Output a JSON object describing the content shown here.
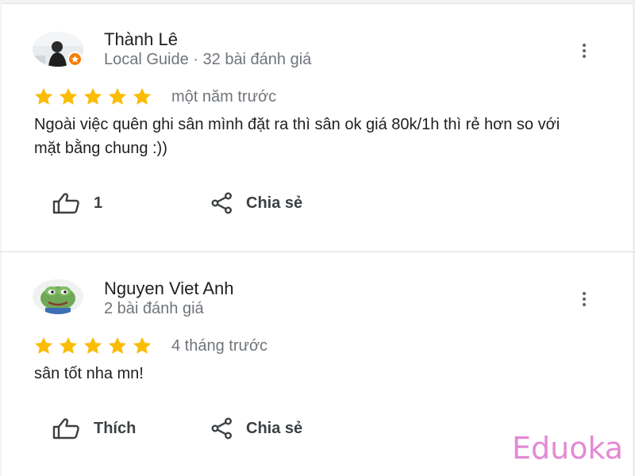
{
  "reviews": [
    {
      "author": "Thành Lê",
      "meta": "Local Guide · 32 bài đánh giá",
      "avatar_icon": "person-photo-avatar",
      "badge_icon": "local-guide-badge-icon",
      "rating": 5,
      "time": "một năm trước",
      "text": "Ngoài việc quên ghi sân mình đặt ra thì sân ok giá 80k/1h thì rẻ hơn so với mặt bằng chung :))",
      "like_label": "1",
      "share_label": "Chia sẻ"
    },
    {
      "author": "Nguyen Viet Anh",
      "meta": "2 bài đánh giá",
      "avatar_icon": "frog-cartoon-avatar",
      "rating": 5,
      "time": "4 tháng trước",
      "text": "sân tốt nha mn!",
      "like_label": "Thích",
      "share_label": "Chia sẻ"
    }
  ],
  "icons": {
    "more": "more-vertical-icon",
    "like": "thumbs-up-icon",
    "share": "share-icon",
    "star": "star-icon"
  },
  "colors": {
    "star": "#fbbc04",
    "secondary_text": "#70757a",
    "badge": "#f57c00",
    "watermark": "#e28ad6"
  },
  "watermark": "Eduoka"
}
